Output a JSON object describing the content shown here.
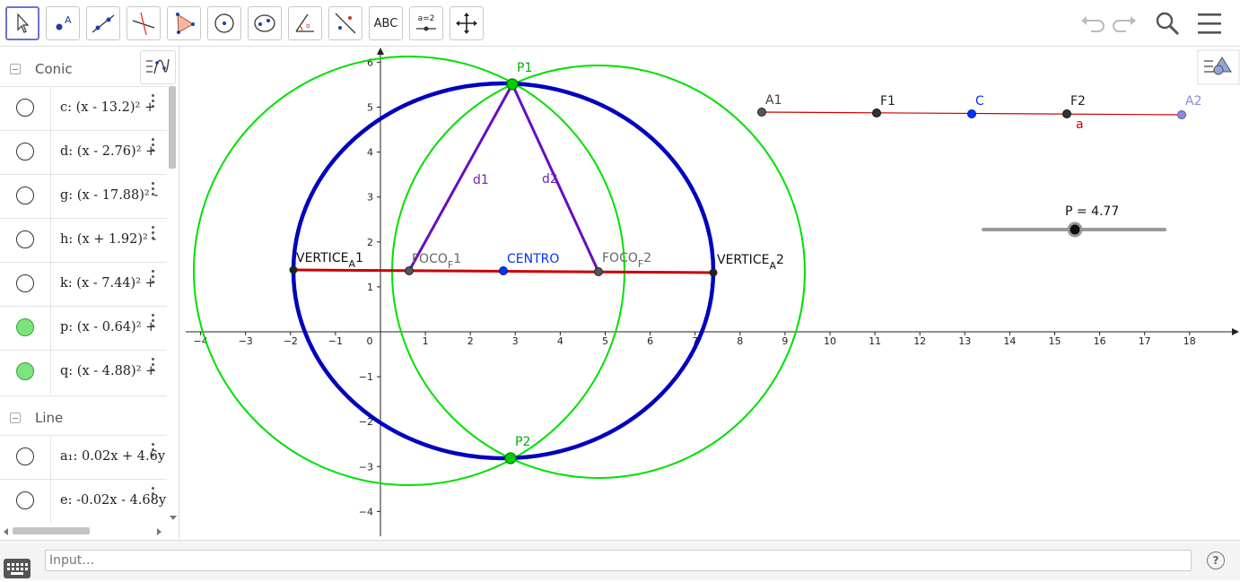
{
  "toolbar": {
    "tools": [
      "move-tool",
      "point-tool",
      "line-tool",
      "perpendicular-line-tool",
      "polygon-tool",
      "circle-center-point-tool",
      "ellipse-tool",
      "angle-tool",
      "reflect-tool",
      "text-tool",
      "slider-tool",
      "move-graphics-view-tool"
    ],
    "text_tool_label": "ABC",
    "slider_tool_label": "a=2",
    "right_icons": [
      "undo-icon",
      "redo-icon",
      "search-icon",
      "menu-icon"
    ]
  },
  "algebra": {
    "groups": [
      {
        "name": "Conic",
        "items": [
          {
            "label": "c",
            "expr": "(x - 13.2)² + ",
            "visible": false
          },
          {
            "label": "d",
            "expr": "(x - 2.76)² + ",
            "visible": false
          },
          {
            "label": "g",
            "expr": "(x - 17.88)² -",
            "visible": false
          },
          {
            "label": "h",
            "expr": "(x + 1.92)² -",
            "visible": false
          },
          {
            "label": "k",
            "expr": "(x - 7.44)² + ",
            "visible": false
          },
          {
            "label": "p",
            "expr": "(x - 0.64)² + ",
            "visible": true
          },
          {
            "label": "q",
            "expr": "(x - 4.88)² + ",
            "visible": true
          }
        ]
      },
      {
        "name": "Line",
        "items": [
          {
            "label": "a₁",
            "expr": "0.02x + 4.6y",
            "visible": false
          },
          {
            "label": "e",
            "expr": "-0.02x - 4.68y",
            "visible": false
          }
        ]
      }
    ]
  },
  "graphics": {
    "x_ticks": [
      -4,
      -3,
      -2,
      -1,
      0,
      1,
      2,
      3,
      4,
      5,
      6,
      7,
      8,
      9,
      10,
      11,
      12,
      13,
      14,
      15,
      16,
      17,
      18
    ],
    "y_ticks": [
      6,
      5,
      4,
      3,
      2,
      1,
      -1,
      -2,
      -3,
      -4
    ],
    "labels": {
      "P1": "P1",
      "P2": "P2",
      "d1": "d1",
      "d2": "d2",
      "vertice1": "VERTICE",
      "vertice1_sub": "A",
      "vertice1_suffix": "1",
      "foco1": "FOCO",
      "foco1_sub": "F",
      "foco1_suffix": "1",
      "centro": "CENTRO",
      "foco2": "FOCO",
      "foco2_sub": "F",
      "foco2_suffix": "2",
      "vertice2": "VERTICE",
      "vertice2_sub": "A",
      "vertice2_suffix": "2",
      "A1": "A1",
      "F1": "F1",
      "C": "C",
      "F2": "F2",
      "A2": "A2",
      "a": "a"
    },
    "slider": {
      "label": "P = 4.77",
      "value": 4.77
    },
    "colors": {
      "ellipse": "#0000bf",
      "circles": "#00e000",
      "axis_segment": "#cc0000",
      "triangle": "#6a0dbf",
      "points": "#00d000",
      "centro": "#0033ff"
    }
  },
  "input": {
    "placeholder": "Input…"
  }
}
